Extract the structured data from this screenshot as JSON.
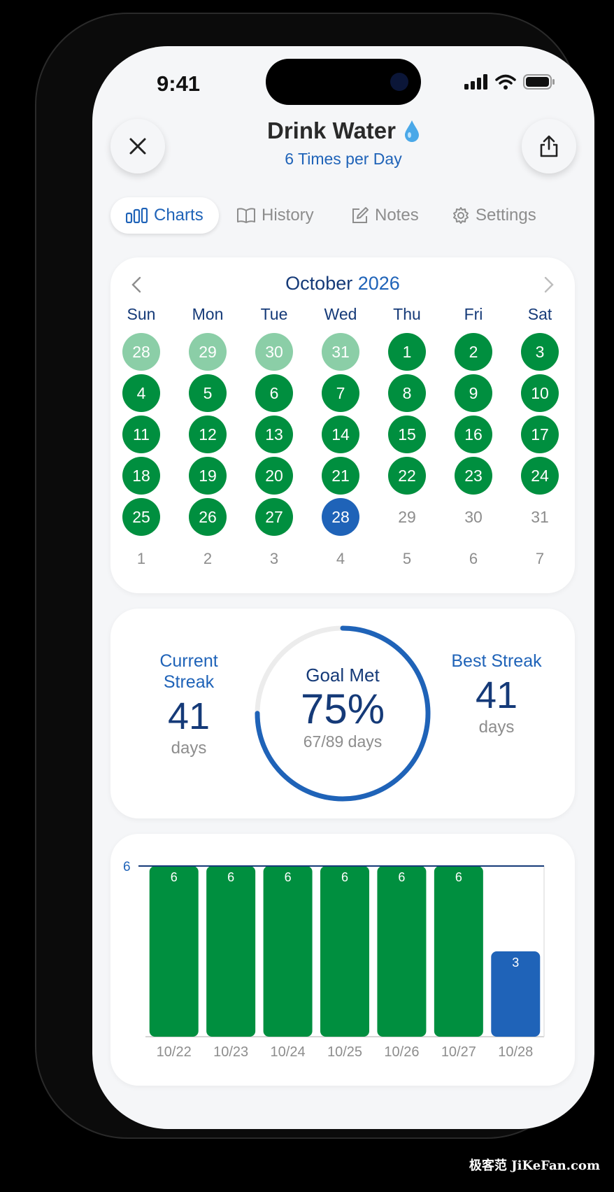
{
  "status_bar": {
    "time": "9:41"
  },
  "header": {
    "title": "Drink Water",
    "title_icon": "water-drop-icon",
    "subtitle": "6 Times per Day",
    "close_icon": "close-icon",
    "share_icon": "share-icon"
  },
  "tabs": [
    {
      "label": "Charts",
      "icon": "bar-chart-icon",
      "active": true
    },
    {
      "label": "History",
      "icon": "book-icon",
      "active": false
    },
    {
      "label": "Notes",
      "icon": "edit-icon",
      "active": false
    },
    {
      "label": "Settings",
      "icon": "gear-icon",
      "active": false
    }
  ],
  "calendar": {
    "month": "October",
    "year": "2026",
    "weekdays": [
      "Sun",
      "Mon",
      "Tue",
      "Wed",
      "Thu",
      "Fri",
      "Sat"
    ],
    "weeks": [
      [
        {
          "d": "28",
          "s": "prev"
        },
        {
          "d": "29",
          "s": "prev"
        },
        {
          "d": "30",
          "s": "prev"
        },
        {
          "d": "31",
          "s": "prev"
        },
        {
          "d": "1",
          "s": "done"
        },
        {
          "d": "2",
          "s": "done"
        },
        {
          "d": "3",
          "s": "done"
        }
      ],
      [
        {
          "d": "4",
          "s": "done"
        },
        {
          "d": "5",
          "s": "done"
        },
        {
          "d": "6",
          "s": "done"
        },
        {
          "d": "7",
          "s": "done"
        },
        {
          "d": "8",
          "s": "done"
        },
        {
          "d": "9",
          "s": "done"
        },
        {
          "d": "10",
          "s": "done"
        }
      ],
      [
        {
          "d": "11",
          "s": "done"
        },
        {
          "d": "12",
          "s": "done"
        },
        {
          "d": "13",
          "s": "done"
        },
        {
          "d": "14",
          "s": "done"
        },
        {
          "d": "15",
          "s": "done"
        },
        {
          "d": "16",
          "s": "done"
        },
        {
          "d": "17",
          "s": "done"
        }
      ],
      [
        {
          "d": "18",
          "s": "done"
        },
        {
          "d": "19",
          "s": "done"
        },
        {
          "d": "20",
          "s": "done"
        },
        {
          "d": "21",
          "s": "done"
        },
        {
          "d": "22",
          "s": "done"
        },
        {
          "d": "23",
          "s": "done"
        },
        {
          "d": "24",
          "s": "done"
        }
      ],
      [
        {
          "d": "25",
          "s": "done"
        },
        {
          "d": "26",
          "s": "done"
        },
        {
          "d": "27",
          "s": "done"
        },
        {
          "d": "28",
          "s": "today"
        },
        {
          "d": "29",
          "s": "future"
        },
        {
          "d": "30",
          "s": "future"
        },
        {
          "d": "31",
          "s": "future"
        }
      ]
    ],
    "week_numbers": [
      "1",
      "2",
      "3",
      "4",
      "5",
      "6",
      "7"
    ]
  },
  "stats": {
    "current_streak_label": "Current Streak",
    "current_streak": "41",
    "current_streak_unit": "days",
    "goal_met_label": "Goal Met",
    "goal_met_percent": "75%",
    "goal_met_days": "67/89 days",
    "goal_met_fraction": 0.75,
    "best_streak_label": "Best Streak",
    "best_streak": "41",
    "best_streak_unit": "days"
  },
  "colors": {
    "done": "#008f3f",
    "prev_month": "#8bcea7",
    "today": "#1f63b8",
    "accent": "#1f63b8",
    "dark_blue": "#153a78"
  },
  "chart_data": {
    "type": "bar",
    "categories": [
      "10/22",
      "10/23",
      "10/24",
      "10/25",
      "10/26",
      "10/27",
      "10/28"
    ],
    "values": [
      6,
      6,
      6,
      6,
      6,
      6,
      3
    ],
    "goal_line": 6,
    "y_tick": "6",
    "ylim": [
      0,
      6
    ],
    "bar_colors": [
      "#008f3f",
      "#008f3f",
      "#008f3f",
      "#008f3f",
      "#008f3f",
      "#008f3f",
      "#1f63b8"
    ],
    "grid": false
  },
  "watermark": "极客范 JiKeFan.com"
}
